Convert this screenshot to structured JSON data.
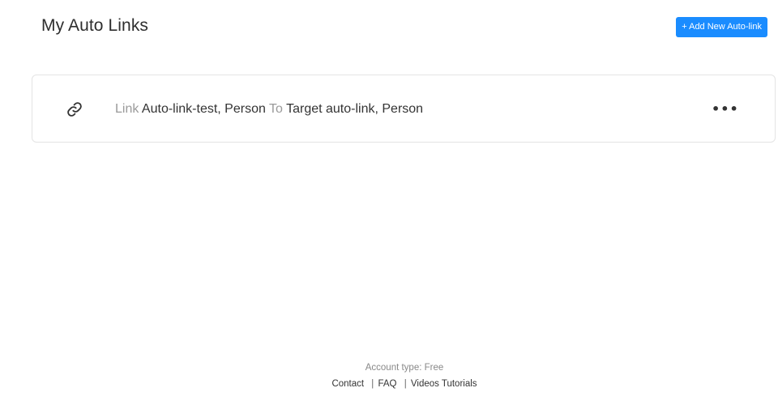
{
  "header": {
    "title": "My Auto Links",
    "add_button_label": "+ Add New Auto-link"
  },
  "auto_links": [
    {
      "link_word": "Link",
      "source": "Auto-link-test, Person",
      "to_word": "To",
      "target": "Target auto-link, Person",
      "icon": "link-icon",
      "more_label": "•••"
    }
  ],
  "footer": {
    "account_type": "Account type: Free",
    "links": [
      "Contact",
      "FAQ",
      "Videos Tutorials"
    ],
    "separator": "|"
  },
  "colors": {
    "accent": "#1a8cff",
    "muted_text": "#9a9a9a",
    "card_border": "#e4e4e4"
  }
}
